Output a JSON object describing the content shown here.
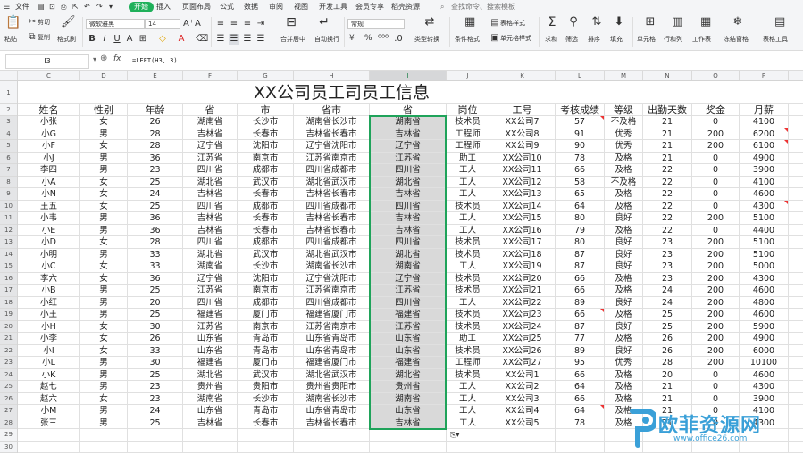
{
  "menubar": {
    "items": [
      "文件",
      "开始",
      "插入",
      "页面布局",
      "公式",
      "数据",
      "审阅",
      "视图",
      "开发工具",
      "会员专享",
      "稻壳资源"
    ],
    "active": "开始",
    "search": "查找命令、搜索模板"
  },
  "ribbon": {
    "paste": "粘贴",
    "cut": "剪切",
    "copy": "复制",
    "format_painter": "格式刷",
    "font_name": "微软雅黑",
    "font_size": "14",
    "merge_center": "合并居中",
    "wrap_text": "自动换行",
    "number_format": "常规",
    "currency": "¥",
    "percent": "%",
    "type_convert": "类型转换",
    "cond_format": "条件格式",
    "table_style": "表格样式",
    "cell_style": "单元格样式",
    "sum": "求和",
    "filter": "筛选",
    "sort": "排序",
    "fill": "填充",
    "cell": "单元格",
    "row_col": "行和列",
    "worksheet": "工作表",
    "freeze": "冻结窗格",
    "table_tools": "表格工具"
  },
  "formula_bar": {
    "name_box": "I3",
    "fx": "fx",
    "formula": "=LEFT(H3, 3)"
  },
  "sheet": {
    "columns": [
      "C",
      "D",
      "E",
      "F",
      "G",
      "H",
      "I",
      "J",
      "K",
      "L",
      "M",
      "N",
      "O",
      "P",
      "Q"
    ],
    "selected_column": "I",
    "title": "XX公司员工司员工信息",
    "headers": [
      "姓名",
      "性别",
      "年龄",
      "省",
      "市",
      "省市",
      "省",
      "岗位",
      "工号",
      "考核成绩",
      "等级",
      "出勤天数",
      "奖金",
      "月薪"
    ],
    "rows": [
      [
        "小张",
        "女",
        "26",
        "湖南省",
        "长沙市",
        "湖南省长沙市",
        "湖南省",
        "技术员",
        "XX公司7",
        "57",
        "不及格",
        "21",
        "0",
        "4100"
      ],
      [
        "小G",
        "男",
        "28",
        "吉林省",
        "长春市",
        "吉林省长春市",
        "吉林省",
        "工程师",
        "XX公司8",
        "91",
        "优秀",
        "21",
        "200",
        "6200"
      ],
      [
        "小F",
        "女",
        "28",
        "辽宁省",
        "沈阳市",
        "辽宁省沈阳市",
        "辽宁省",
        "工程师",
        "XX公司9",
        "90",
        "优秀",
        "21",
        "200",
        "6100"
      ],
      [
        "小J",
        "男",
        "36",
        "江苏省",
        "南京市",
        "江苏省南京市",
        "江苏省",
        "助工",
        "XX公司10",
        "78",
        "及格",
        "21",
        "0",
        "4900"
      ],
      [
        "李四",
        "男",
        "23",
        "四川省",
        "成都市",
        "四川省成都市",
        "四川省",
        "工人",
        "XX公司11",
        "66",
        "及格",
        "22",
        "0",
        "3900"
      ],
      [
        "小A",
        "女",
        "25",
        "湖北省",
        "武汉市",
        "湖北省武汉市",
        "湖北省",
        "工人",
        "XX公司12",
        "58",
        "不及格",
        "22",
        "0",
        "4100"
      ],
      [
        "小N",
        "女",
        "24",
        "吉林省",
        "长春市",
        "吉林省长春市",
        "吉林省",
        "工人",
        "XX公司13",
        "65",
        "及格",
        "22",
        "0",
        "4600"
      ],
      [
        "王五",
        "女",
        "25",
        "四川省",
        "成都市",
        "四川省成都市",
        "四川省",
        "技术员",
        "XX公司14",
        "64",
        "及格",
        "22",
        "0",
        "4300"
      ],
      [
        "小韦",
        "男",
        "36",
        "吉林省",
        "长春市",
        "吉林省长春市",
        "吉林省",
        "工人",
        "XX公司15",
        "80",
        "良好",
        "22",
        "200",
        "5100"
      ],
      [
        "小E",
        "男",
        "36",
        "吉林省",
        "长春市",
        "吉林省长春市",
        "吉林省",
        "工人",
        "XX公司16",
        "79",
        "及格",
        "22",
        "0",
        "4400"
      ],
      [
        "小D",
        "女",
        "28",
        "四川省",
        "成都市",
        "四川省成都市",
        "四川省",
        "技术员",
        "XX公司17",
        "80",
        "良好",
        "23",
        "200",
        "5100"
      ],
      [
        "小明",
        "男",
        "33",
        "湖北省",
        "武汉市",
        "湖北省武汉市",
        "湖北省",
        "技术员",
        "XX公司18",
        "87",
        "良好",
        "23",
        "200",
        "5100"
      ],
      [
        "小C",
        "女",
        "33",
        "湖南省",
        "长沙市",
        "湖南省长沙市",
        "湖南省",
        "工人",
        "XX公司19",
        "87",
        "良好",
        "23",
        "200",
        "5000"
      ],
      [
        "李六",
        "女",
        "36",
        "辽宁省",
        "沈阳市",
        "辽宁省沈阳市",
        "辽宁省",
        "技术员",
        "XX公司20",
        "66",
        "及格",
        "23",
        "200",
        "4300"
      ],
      [
        "小B",
        "男",
        "25",
        "江苏省",
        "南京市",
        "江苏省南京市",
        "江苏省",
        "技术员",
        "XX公司21",
        "66",
        "及格",
        "24",
        "200",
        "4600"
      ],
      [
        "小红",
        "男",
        "20",
        "四川省",
        "成都市",
        "四川省成都市",
        "四川省",
        "工人",
        "XX公司22",
        "89",
        "良好",
        "24",
        "200",
        "4800"
      ],
      [
        "小王",
        "男",
        "25",
        "福建省",
        "厦门市",
        "福建省厦门市",
        "福建省",
        "技术员",
        "XX公司23",
        "66",
        "及格",
        "25",
        "200",
        "4600"
      ],
      [
        "小H",
        "女",
        "30",
        "江苏省",
        "南京市",
        "江苏省南京市",
        "江苏省",
        "技术员",
        "XX公司24",
        "87",
        "良好",
        "25",
        "200",
        "5900"
      ],
      [
        "小李",
        "女",
        "26",
        "山东省",
        "青岛市",
        "山东省青岛市",
        "山东省",
        "助工",
        "XX公司25",
        "77",
        "及格",
        "26",
        "200",
        "4900"
      ],
      [
        "小I",
        "女",
        "33",
        "山东省",
        "青岛市",
        "山东省青岛市",
        "山东省",
        "技术员",
        "XX公司26",
        "89",
        "良好",
        "26",
        "200",
        "6000"
      ],
      [
        "小L",
        "男",
        "30",
        "福建省",
        "厦门市",
        "福建省厦门市",
        "福建省",
        "工程师",
        "XX公司27",
        "95",
        "优秀",
        "28",
        "200",
        "10100"
      ],
      [
        "小K",
        "男",
        "25",
        "湖北省",
        "武汉市",
        "湖北省武汉市",
        "湖北省",
        "技术员",
        "XX公司1",
        "66",
        "及格",
        "20",
        "0",
        "4600"
      ],
      [
        "赵七",
        "男",
        "23",
        "贵州省",
        "贵阳市",
        "贵州省贵阳市",
        "贵州省",
        "工人",
        "XX公司2",
        "64",
        "及格",
        "21",
        "0",
        "4300"
      ],
      [
        "赵六",
        "女",
        "23",
        "湖南省",
        "长沙市",
        "湖南省长沙市",
        "湖南省",
        "工人",
        "XX公司3",
        "66",
        "及格",
        "21",
        "0",
        "3900"
      ],
      [
        "小M",
        "男",
        "24",
        "山东省",
        "青岛市",
        "山东省青岛市",
        "山东省",
        "工人",
        "XX公司4",
        "64",
        "及格",
        "21",
        "0",
        "4100"
      ],
      [
        "张三",
        "男",
        "25",
        "吉林省",
        "长春市",
        "吉林省长春市",
        "吉林省",
        "工人",
        "XX公司5",
        "78",
        "及格",
        "21",
        "0",
        "4300"
      ]
    ],
    "comment_marks": [
      [
        0,
        9
      ],
      [
        1,
        13
      ],
      [
        2,
        13
      ],
      [
        7,
        13
      ],
      [
        16,
        9
      ],
      [
        24,
        9
      ]
    ],
    "paste_options_icon": "paste-options-icon"
  },
  "watermark": {
    "name": "欧菲资源网",
    "url": "www.office26.com"
  },
  "colors": {
    "accent": "#1fb05a",
    "selection_border": "#1fa35a",
    "selected_fill": "#d9d9d9",
    "comment_mark": "#e33333",
    "watermark": "#3aa0d8"
  }
}
